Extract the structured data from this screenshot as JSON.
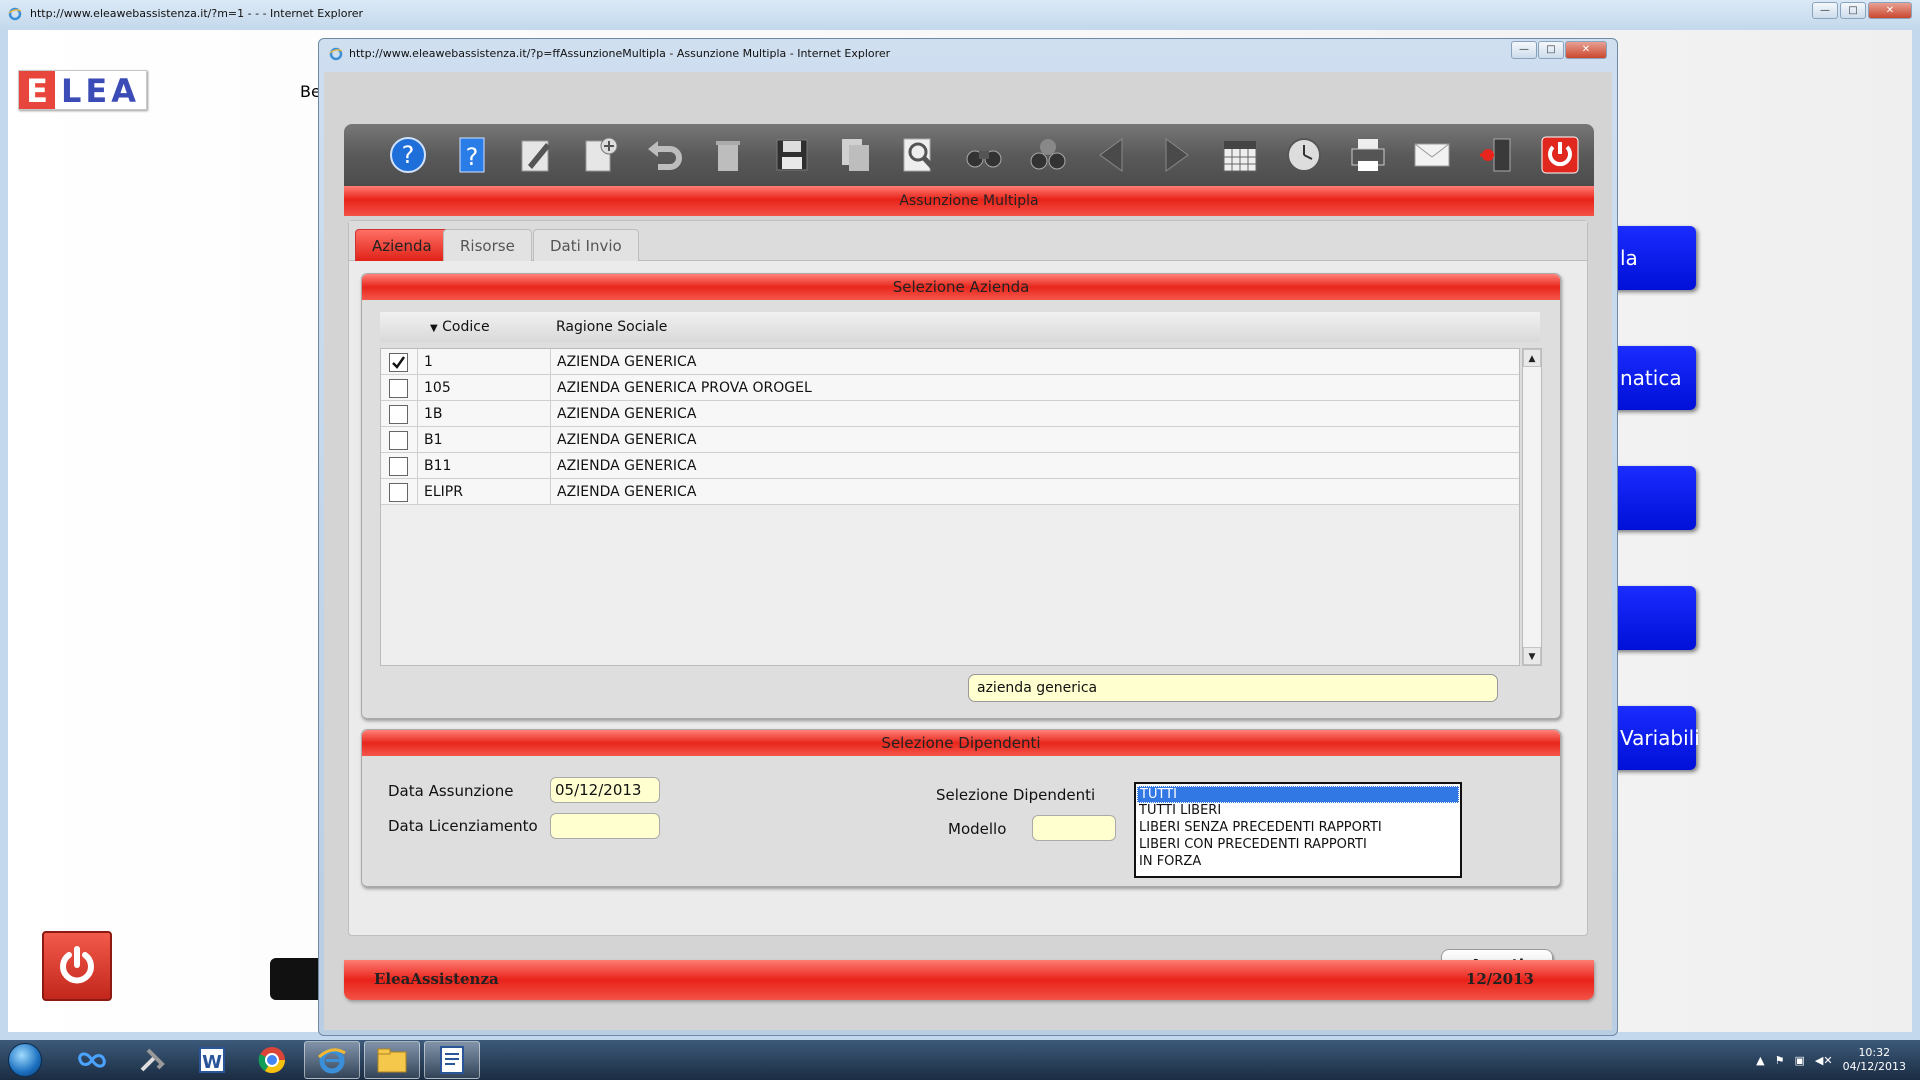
{
  "background_window": {
    "title": "http://www.eleawebassistenza.it/?m=1 - - - Internet Explorer",
    "logo_first": "E",
    "logo_rest": "LEA",
    "greeting": "Be",
    "side_buttons": [
      "la",
      "natica",
      "",
      "",
      "Variabili"
    ]
  },
  "popup": {
    "title": "http://www.eleawebassistenza.it/?p=ffAssunzioneMultipla - Assunzione Multipla - Internet Explorer",
    "page_title": "Assunzione Multipla"
  },
  "toolbar": {
    "icons": [
      "help-icon",
      "help-book-icon",
      "edit-icon",
      "new-record-icon",
      "undo-icon",
      "delete-icon",
      "save-icon",
      "copy-icon",
      "search-icon",
      "binoculars-icon",
      "binoculars-advanced-icon",
      "previous-icon",
      "next-icon",
      "calendar-icon",
      "clock-icon",
      "print-icon",
      "mail-icon",
      "exit-door-icon",
      "power-off-icon"
    ]
  },
  "tabs": [
    {
      "label": "Azienda",
      "active": true
    },
    {
      "label": "Risorse",
      "active": false
    },
    {
      "label": "Dati Invio",
      "active": false
    }
  ],
  "selezione_azienda": {
    "title": "Selezione Azienda",
    "col_codice": "Codice",
    "col_ragione": "Ragione Sociale",
    "rows": [
      {
        "checked": true,
        "code": "1",
        "name": "AZIENDA GENERICA"
      },
      {
        "checked": false,
        "code": "105",
        "name": "AZIENDA GENERICA PROVA OROGEL"
      },
      {
        "checked": false,
        "code": "1B",
        "name": "AZIENDA GENERICA"
      },
      {
        "checked": false,
        "code": "B1",
        "name": "AZIENDA GENERICA"
      },
      {
        "checked": false,
        "code": "B11",
        "name": "AZIENDA GENERICA"
      },
      {
        "checked": false,
        "code": "ELIPR",
        "name": "AZIENDA GENERICA"
      }
    ],
    "search_value": "azienda generica"
  },
  "selezione_dipendenti": {
    "title": "Selezione Dipendenti",
    "data_assunzione_label": "Data Assunzione",
    "data_assunzione_value": "05/12/2013",
    "data_licenziamento_label": "Data Licenziamento",
    "data_licenziamento_value": "",
    "selezione_label": "Selezione Dipendenti",
    "modello_label": "Modello",
    "modello_value": "",
    "options": [
      "TUTTI",
      "TUTTI LIBERI",
      "LIBERI SENZA PRECEDENTI RAPPORTI",
      "LIBERI CON PRECEDENTI RAPPORTI",
      "IN FORZA"
    ],
    "selected_option": "TUTTI"
  },
  "avanti_label": "Avanti",
  "footer": {
    "left": "EleaAssistenza",
    "right": "12/2013"
  },
  "taskbar": {
    "time": "10:32",
    "date": "04/12/2013",
    "apps": [
      "infinity-app-icon",
      "tools-app-icon",
      "word-icon",
      "chrome-icon",
      "internet-explorer-icon",
      "folder-icon",
      "document-icon"
    ]
  }
}
